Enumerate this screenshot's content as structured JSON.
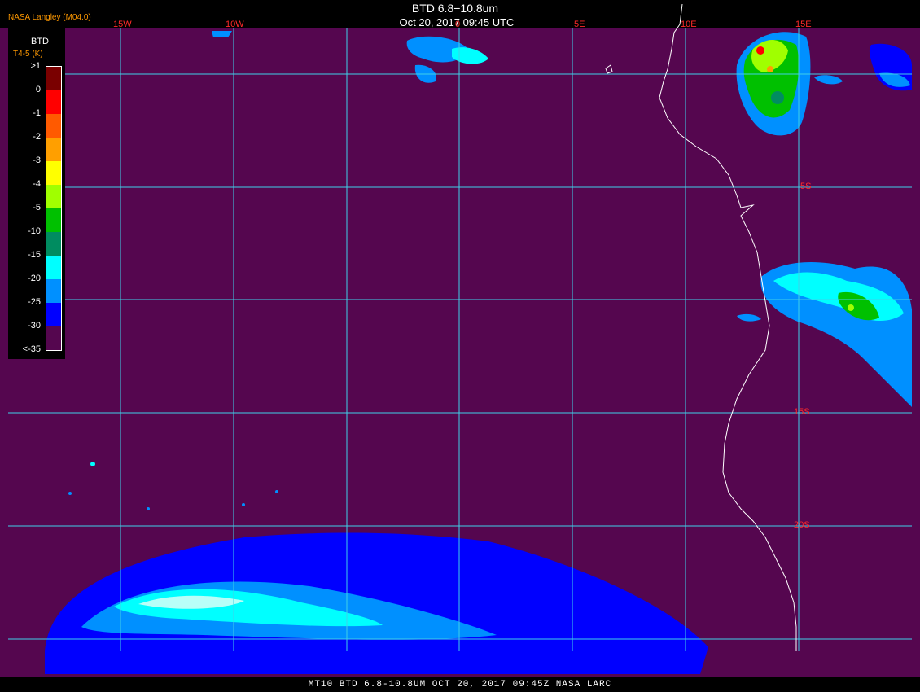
{
  "header": {
    "title": "BTD 6.8−10.8um",
    "subtitle": "Oct 20, 2017 09:45 UTC",
    "producer": "NASA Langley (M04.0)"
  },
  "footer": "MT10   BTD 6.8-10.8UM   OCT 20, 2017 09:45Z   NASA LARC",
  "map": {
    "background_color": "#55064f",
    "grid_color": "#3fd0e8",
    "coastline_color": "#ffffff",
    "longitude_labels": [
      "15W",
      "10W",
      "0",
      "5E",
      "10E",
      "15E"
    ],
    "latitude_labels": [
      "5S",
      "15S",
      "20S"
    ]
  },
  "legend": {
    "title": "BTD",
    "units": "T4-5 (K)",
    "labels": [
      ">1",
      "0",
      "-1",
      "-2",
      "-3",
      "-4",
      "-5",
      "-10",
      "-15",
      "-20",
      "-25",
      "-30",
      "<-35"
    ],
    "colors": [
      "#7a0000",
      "#ff0000",
      "#ff5a00",
      "#ff9f00",
      "#ffff00",
      "#a0ff00",
      "#00c000",
      "#008c60",
      "#00ffff",
      "#0090ff",
      "#0000ff",
      "#55064f"
    ]
  }
}
